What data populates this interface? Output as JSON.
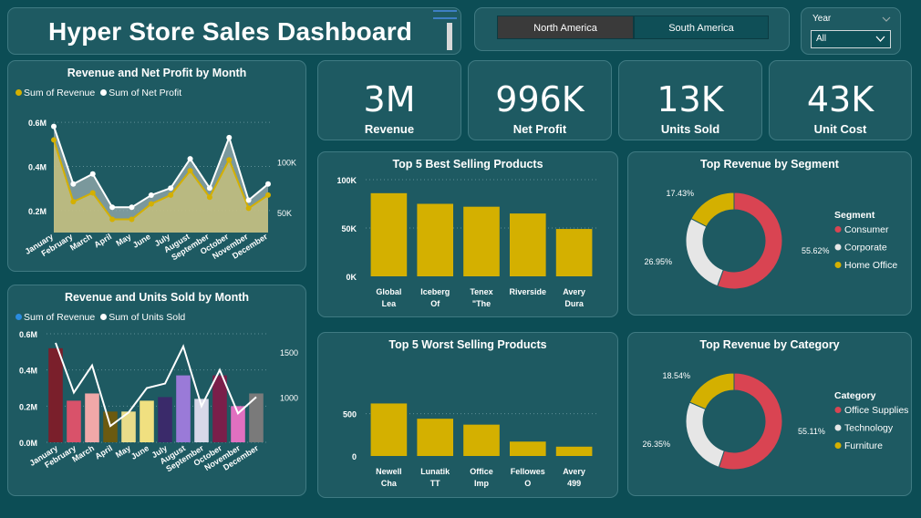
{
  "header": {
    "title": "Hyper Store Sales Dashboard"
  },
  "regions": [
    "North America",
    "South America"
  ],
  "year_filter": {
    "label": "Year",
    "value": "All"
  },
  "kpis": [
    {
      "value": "3M",
      "label": "Revenue"
    },
    {
      "value": "996K",
      "label": "Net Profit"
    },
    {
      "value": "13K",
      "label": "Units Sold"
    },
    {
      "value": "43K",
      "label": "Unit Cost"
    }
  ],
  "months": [
    "January",
    "February",
    "March",
    "April",
    "May",
    "June",
    "July",
    "August",
    "September",
    "October",
    "November",
    "December"
  ],
  "chart1": {
    "title": "Revenue and Net Profit by Month",
    "legend": [
      "Sum of Revenue",
      "Sum of Net Profit"
    ],
    "y_ticks": [
      "0.6M",
      "0.4M",
      "0.2M"
    ],
    "y2_ticks": [
      "100K",
      "50K"
    ],
    "revenue_color": "#d4b000",
    "profit_color": "#ffffff"
  },
  "chart2": {
    "title": "Revenue and Units Sold by Month",
    "legend": [
      "Sum of Revenue",
      "Sum of Units Sold"
    ],
    "y_ticks": [
      "0.6M",
      "0.4M",
      "0.2M",
      "0.0M"
    ],
    "y2_ticks": [
      "1500",
      "1000"
    ],
    "revenue_legend_color": "#2a8ce0",
    "bar_colors": [
      "#7a1f2b",
      "#d9526a",
      "#f0a8a8",
      "#6b5a10",
      "#e8dc8a",
      "#f0e080",
      "#3a2a6a",
      "#9a7ad8",
      "#d8d8e8",
      "#7a1f4a",
      "#e070c0",
      "#7a7a7a"
    ]
  },
  "chart3": {
    "title": "Top 5 Best Selling Products",
    "y_ticks": [
      "100K",
      "50K",
      "0K"
    ],
    "bar_color": "#d4b000"
  },
  "chart4": {
    "title": "Top 5 Worst Selling Products",
    "y_ticks": [
      "500",
      "0"
    ],
    "bar_color": "#d4b000"
  },
  "chart5": {
    "title": "Top Revenue by Segment",
    "legend_title": "Segment"
  },
  "chart6": {
    "title": "Top Revenue by Category",
    "legend_title": "Category"
  },
  "chart_data": [
    {
      "type": "area",
      "title": "Revenue and Net Profit by Month",
      "categories": [
        "January",
        "February",
        "March",
        "April",
        "May",
        "June",
        "July",
        "August",
        "September",
        "October",
        "November",
        "December"
      ],
      "series": [
        {
          "name": "Sum of Revenue",
          "axis": "left",
          "values": [
            0.52,
            0.24,
            0.28,
            0.16,
            0.16,
            0.23,
            0.27,
            0.38,
            0.26,
            0.43,
            0.21,
            0.27
          ]
        },
        {
          "name": "Sum of Net Profit",
          "axis": "right",
          "values": [
            135000,
            78000,
            88000,
            55000,
            55000,
            67000,
            74000,
            103000,
            74000,
            124000,
            62000,
            78000
          ]
        }
      ],
      "ylim": [
        0.1,
        0.65
      ],
      "y2lim": [
        30000,
        150000
      ]
    },
    {
      "type": "bar",
      "title": "Revenue and Units Sold by Month",
      "categories": [
        "January",
        "February",
        "March",
        "April",
        "May",
        "June",
        "July",
        "August",
        "September",
        "October",
        "November",
        "December"
      ],
      "series": [
        {
          "name": "Sum of Revenue",
          "axis": "left",
          "values": [
            0.52,
            0.23,
            0.27,
            0.17,
            0.17,
            0.23,
            0.25,
            0.37,
            0.24,
            0.37,
            0.2,
            0.27
          ]
        },
        {
          "name": "Sum of Units Sold",
          "axis": "right",
          "values": [
            1600,
            1050,
            1350,
            680,
            830,
            1100,
            1150,
            1560,
            900,
            1300,
            820,
            1000
          ]
        }
      ],
      "ylim": [
        0,
        0.6
      ],
      "y2lim": [
        500,
        1700
      ]
    },
    {
      "type": "bar",
      "title": "Top 5 Best Selling Products",
      "categories": [
        "Global Lea",
        "Iceberg Of",
        "Tenex \"The",
        "Riverside",
        "Avery Dura"
      ],
      "values": [
        86000,
        75000,
        72000,
        65000,
        49000
      ],
      "ylim": [
        0,
        100000
      ]
    },
    {
      "type": "bar",
      "title": "Top 5 Worst Selling Products",
      "categories": [
        "Newell Cha",
        "Lunatik TT",
        "Office Imp",
        "Fellowes O",
        "Avery 499"
      ],
      "values": [
        620,
        440,
        370,
        170,
        110
      ],
      "ylim": [
        0,
        700
      ]
    },
    {
      "type": "pie",
      "title": "Top Revenue by Segment",
      "labels": [
        "Consumer",
        "Corporate",
        "Home Office"
      ],
      "values": [
        55.62,
        26.95,
        17.43
      ],
      "value_labels": [
        "55.62%",
        "26.95%",
        "17.43%"
      ],
      "colors": [
        "#d94452",
        "#e6e6e6",
        "#d4b000"
      ]
    },
    {
      "type": "pie",
      "title": "Top Revenue by Category",
      "labels": [
        "Office Supplies",
        "Technology",
        "Furniture"
      ],
      "values": [
        55.11,
        26.35,
        18.54
      ],
      "value_labels": [
        "55.11%",
        "26.35%",
        "18.54%"
      ],
      "colors": [
        "#d94452",
        "#e6e6e6",
        "#d4b000"
      ]
    }
  ]
}
